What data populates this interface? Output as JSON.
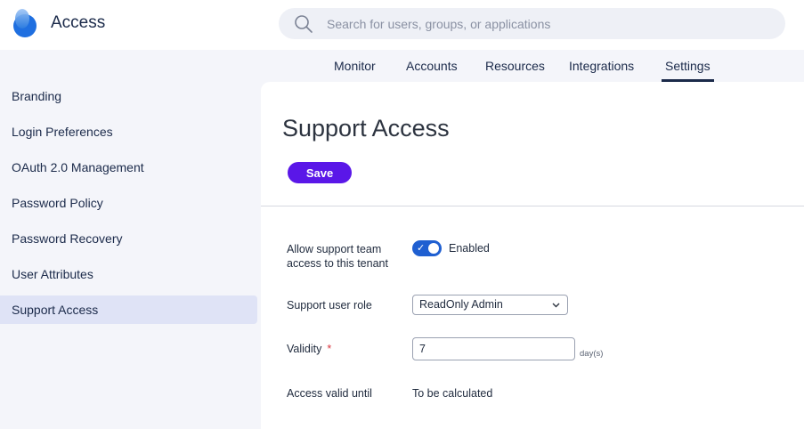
{
  "header": {
    "app_title": "Access",
    "search": {
      "placeholder": "Search for users, groups, or applications",
      "value": ""
    }
  },
  "topnav": {
    "tabs": [
      {
        "label": "Monitor"
      },
      {
        "label": "Accounts"
      },
      {
        "label": "Resources"
      },
      {
        "label": "Integrations"
      },
      {
        "label": "Settings",
        "active": true
      }
    ]
  },
  "sidebar": {
    "items": [
      {
        "label": "Branding"
      },
      {
        "label": "Login Preferences"
      },
      {
        "label": "OAuth 2.0 Management"
      },
      {
        "label": "Password Policy"
      },
      {
        "label": "Password Recovery"
      },
      {
        "label": "User Attributes"
      },
      {
        "label": "Support Access",
        "active": true
      }
    ]
  },
  "main": {
    "title": "Support Access",
    "save_label": "Save",
    "form": {
      "allow_label_line1": "Allow support team",
      "allow_label_line2": "access to this tenant",
      "allow_toggle_on": true,
      "allow_toggle_text": "Enabled",
      "role_label": "Support user role",
      "role_value": "ReadOnly Admin",
      "validity_label": "Validity",
      "validity_required_mark": "*",
      "validity_value": "7",
      "validity_unit": "day(s)",
      "valid_until_label": "Access valid until",
      "valid_until_value": "To be calculated"
    }
  },
  "colors": {
    "accent": "#5a17e8",
    "toggle_on": "#1f5fd1",
    "nav_text": "#1b2a4a",
    "sidebar_active": "#dfe3f6",
    "required": "#d9363e"
  },
  "icons": [
    "logo-icon",
    "search-icon",
    "check-icon",
    "chevron-down-icon"
  ]
}
